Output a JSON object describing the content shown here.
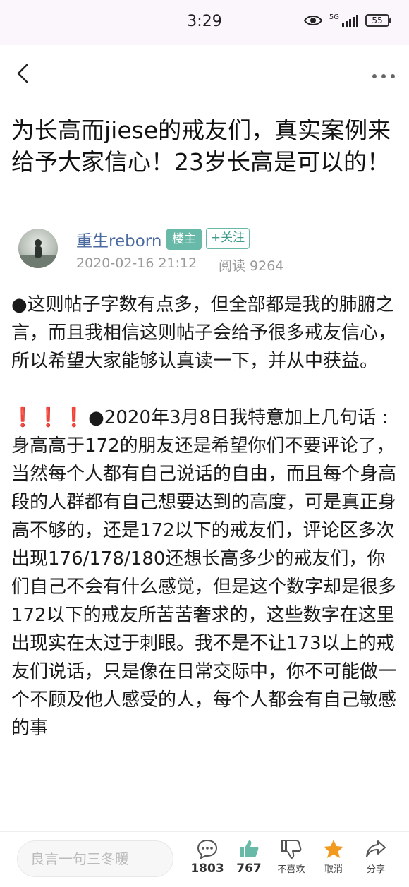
{
  "status_bar": {
    "time": "3:29",
    "network": "5G",
    "battery": "55"
  },
  "post": {
    "title": "为长高而jiese的戒友们，真实案例来给予大家信心！23岁长高是可以的！",
    "author": {
      "name": "重生reborn",
      "badge": "楼主",
      "follow_label": "+关注",
      "date": "2020-02-16 21:12",
      "reads": "阅读 9264"
    },
    "paragraphs": [
      "●这则帖子字数有点多，但全部都是我的肺腑之言，而且我相信这则帖子会给予很多戒友信心，所以希望大家能够认真读一下，并从中获益。",
      "●2020年3月8日我特意加上几句话 :身高高于172的朋友还是希望你们不要评论了，当然每个人都有自己说话的自由，而且每个身高段的人群都有自己想要达到的高度，可是真正身高不够的，还是172以下的戒友们，评论区多次出现176/178/180还想长高多少的戒友们，你们自己不会有什么感觉，但是这个数字却是很多172以下的戒友所苦苦奢求的，这些数字在这里出现实在太过于刺眼。我不是不让173以上的戒友们说话，只是像在日常交际中，你不可能做一个不顾及他人感受的人，每个人都会有自己敏感的事"
    ],
    "emphasis_marks": "❗❗❗"
  },
  "bottom_bar": {
    "comment_placeholder": "良言一句三冬暖",
    "comments_count": "1803",
    "likes_count": "767",
    "dislike_label": "不喜欢",
    "favorite_label": "取消",
    "share_label": "分享"
  },
  "colors": {
    "accent": "#69b9a8",
    "author_name": "#4a6aa0",
    "favorite_star": "#f29a1f",
    "like_thumb": "#69b9a8"
  },
  "icons": [
    "eye-icon",
    "signal-icon",
    "battery-icon",
    "back-arrow-icon",
    "more-icon",
    "comment-icon",
    "thumbs-up-icon",
    "thumbs-down-icon",
    "star-icon",
    "share-icon"
  ]
}
